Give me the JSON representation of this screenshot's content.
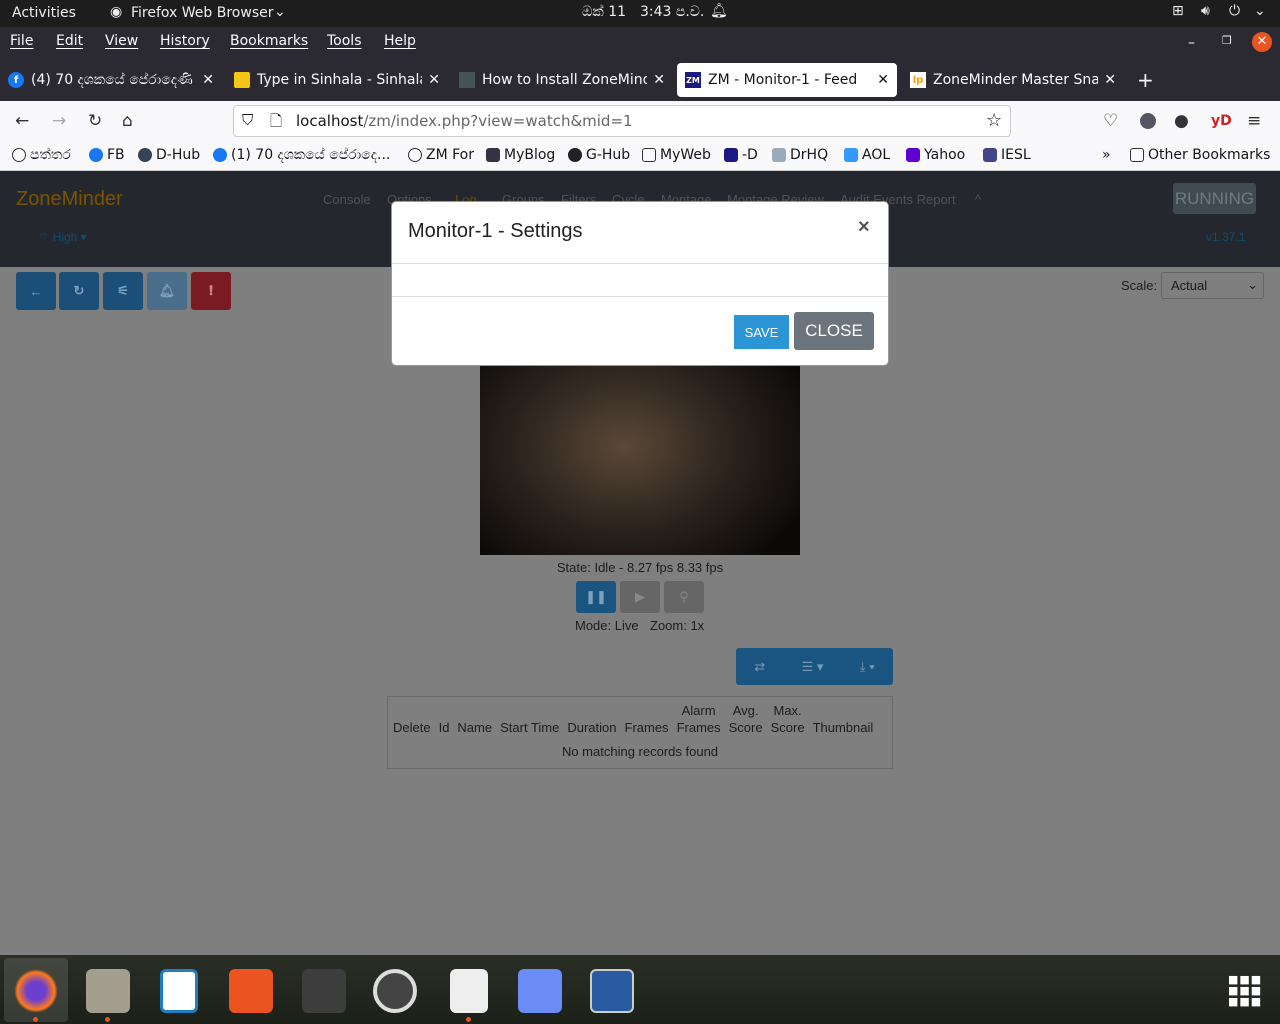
{
  "system_bar": {
    "activities": "Activities",
    "app_name": "Firefox Web Browser",
    "date": "ඔක් 11",
    "time": "3:43 ප.ව."
  },
  "menu": [
    "File",
    "Edit",
    "View",
    "History",
    "Bookmarks",
    "Tools",
    "Help"
  ],
  "tabs": [
    {
      "title": "(4) 70 දශකයේ පේරාදෙණි",
      "icon": "facebook-icon"
    },
    {
      "title": "Type in Sinhala - Sinhala R",
      "icon": "sinhala-icon"
    },
    {
      "title": "How to Install ZoneMinder",
      "icon": "blog-icon"
    },
    {
      "title": "ZM - Monitor-1 - Feed",
      "icon": "zm-icon",
      "active": true
    },
    {
      "title": "ZoneMinder Master Snap",
      "icon": "lp-icon"
    }
  ],
  "url": {
    "host": "localhost",
    "path": "/zm/index.php?view=watch&mid=1"
  },
  "bookmarks": [
    "පත්තර",
    "FB",
    "D-Hub",
    "(1) 70 දශකයේ පේරාදෙ...",
    "ZM For",
    "MyBlog",
    "G-Hub",
    "MyWeb",
    "-D",
    "DrHQ",
    "AOL",
    "Yahoo",
    "IESL"
  ],
  "other_bookmarks": "Other Bookmarks",
  "zm": {
    "brand": "ZoneMinder",
    "nav": [
      "Console",
      "Options",
      "Log",
      "Groups",
      "Filters",
      "Cycle",
      "Montage",
      "Montage Review",
      "Audit Events Report"
    ],
    "bandwidth": "High",
    "status": "RUNNING",
    "version": "v1.37.1",
    "scale_label": "Scale:",
    "scale_value": "Actual",
    "state": "State: Idle - 8.27 fps 8.33 fps",
    "mode": "Mode: Live",
    "zoom": "Zoom: 1x",
    "table_headers": [
      [
        "",
        "Delete"
      ],
      [
        "",
        "Id"
      ],
      [
        "",
        "Name"
      ],
      [
        "",
        "Start Time"
      ],
      [
        "",
        "Duration"
      ],
      [
        "",
        "Frames"
      ],
      [
        "Alarm",
        "Frames"
      ],
      [
        "Avg.",
        "Score"
      ],
      [
        "Max.",
        "Score"
      ],
      [
        "",
        "Thumbnail"
      ]
    ],
    "empty": "No matching records found"
  },
  "modal": {
    "title": "Monitor-1 - Settings",
    "save": "SAVE",
    "close": "CLOSE"
  },
  "colors": {
    "zm_brand": "#a06b00",
    "primary": "#1a5480",
    "danger": "#7a1a22",
    "close_red": "#e95420"
  }
}
